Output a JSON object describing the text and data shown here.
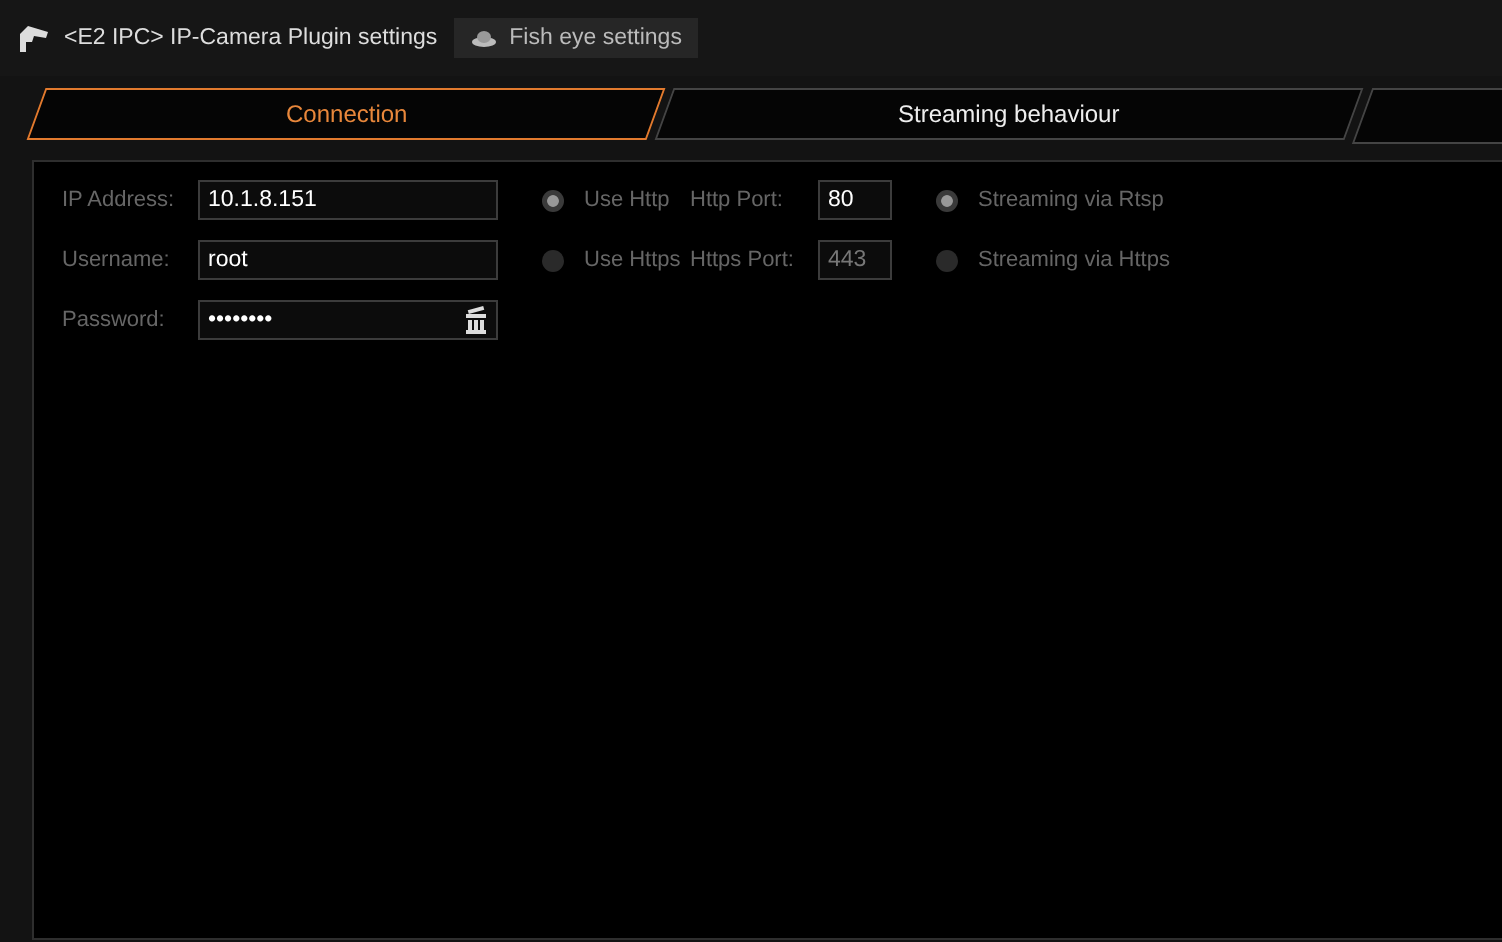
{
  "header_tabs": [
    {
      "label": "<E2 IPC> IP-Camera Plugin settings",
      "selected": true
    },
    {
      "label": "Fish eye settings",
      "selected": false
    }
  ],
  "tabs": [
    {
      "label": "Connection",
      "selected": true
    },
    {
      "label": "Streaming behaviour",
      "selected": false
    }
  ],
  "form": {
    "rows": [
      {
        "label": "IP Address:",
        "value": "10.1.8.151",
        "protocol": {
          "label": "Use Http",
          "selected": true
        },
        "port_label": "Http Port:",
        "port": {
          "value": "80",
          "disabled": false
        },
        "streaming": {
          "label": "Streaming via Rtsp",
          "selected": true
        }
      },
      {
        "label": "Username:",
        "value": "root",
        "protocol": {
          "label": "Use Https",
          "selected": false
        },
        "port_label": "Https Port:",
        "port": {
          "value": "443",
          "disabled": true
        },
        "streaming": {
          "label": "Streaming via Https",
          "selected": false
        }
      },
      {
        "label": "Password:",
        "value": "••••••••",
        "clear_button": true
      }
    ]
  }
}
